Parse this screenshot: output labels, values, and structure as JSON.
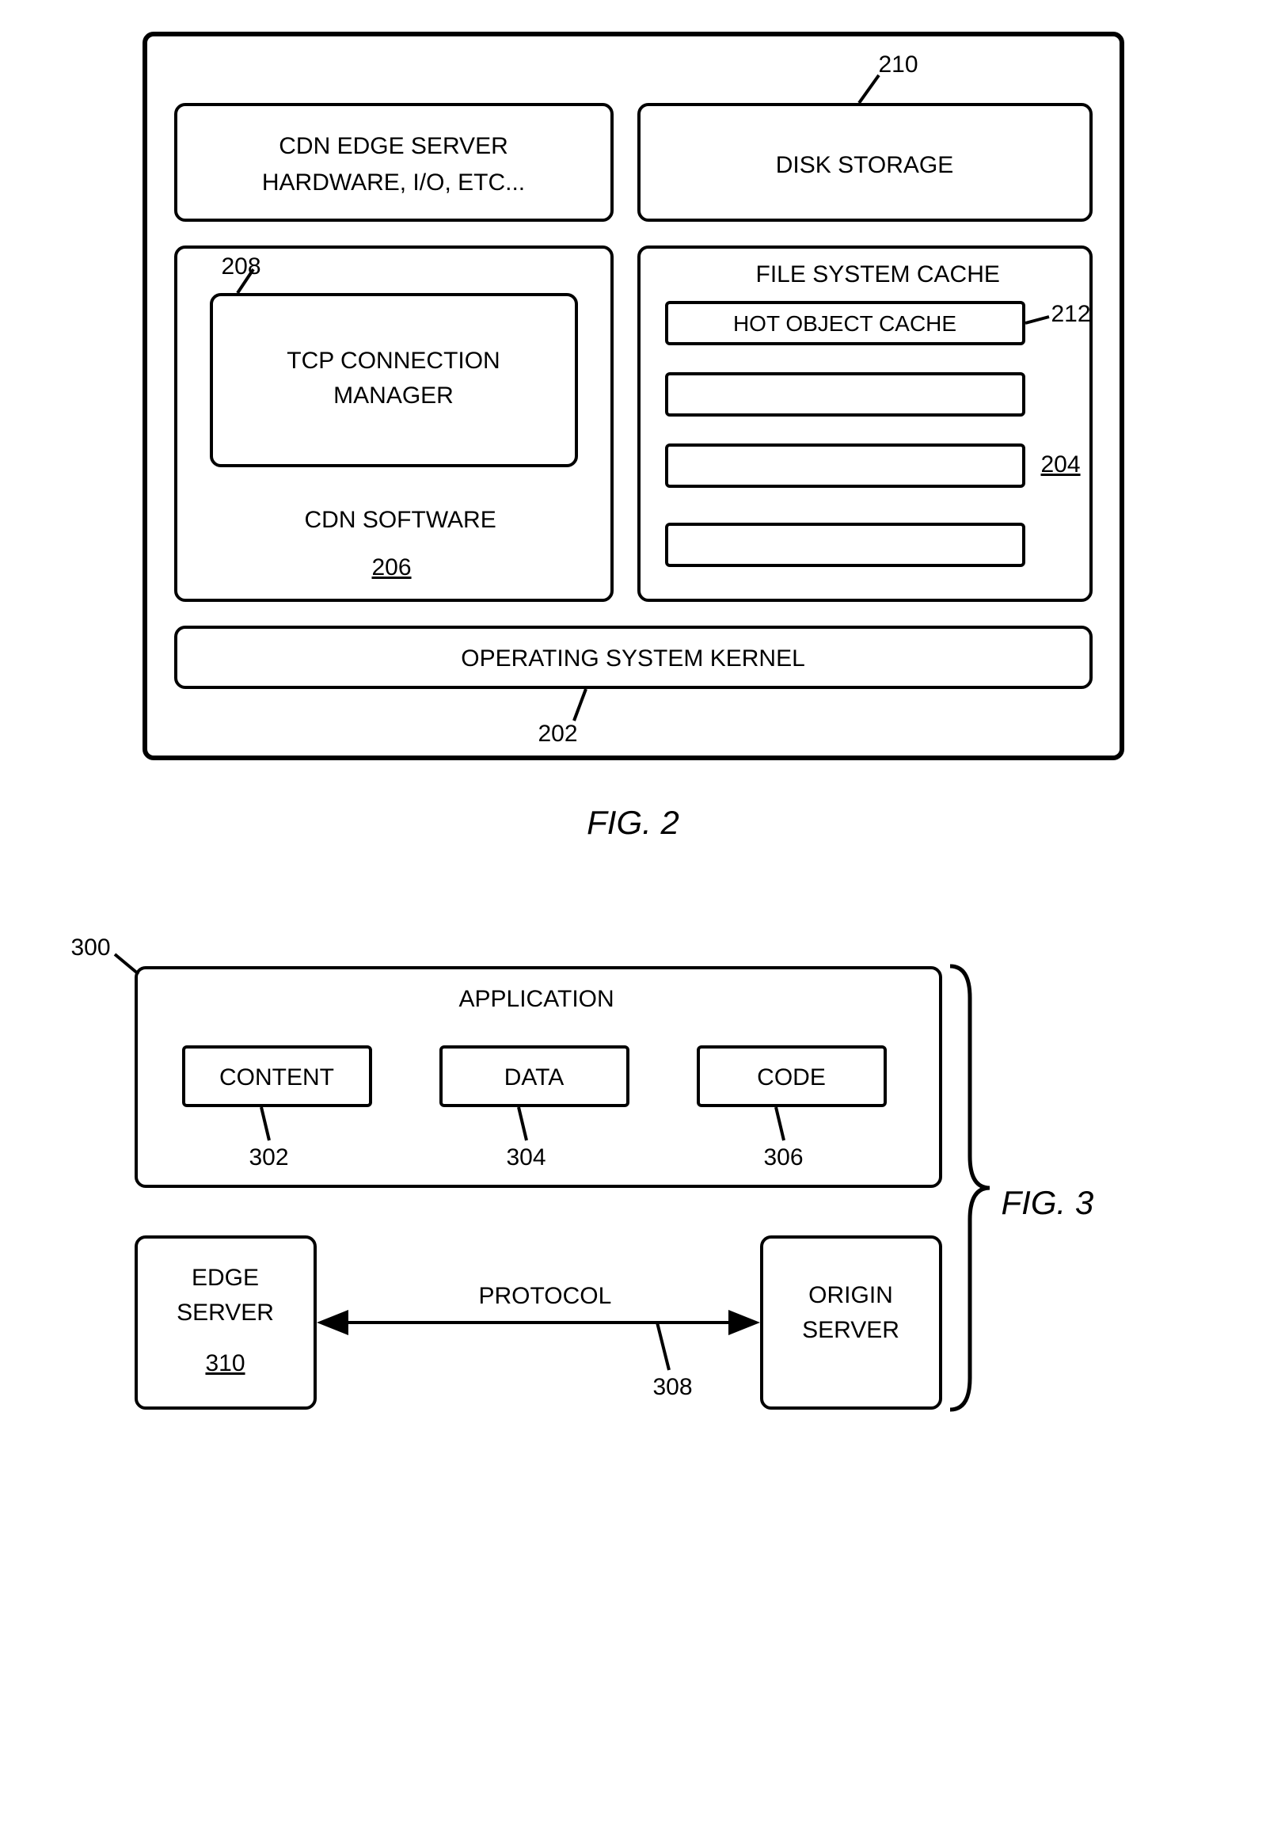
{
  "fig2": {
    "edge_server_hw_l1": "CDN EDGE SERVER",
    "edge_server_hw_l2": "HARDWARE, I/O, ETC...",
    "disk_storage": "DISK STORAGE",
    "tcp_conn_mgr_l1": "TCP CONNECTION",
    "tcp_conn_mgr_l2": "MANAGER",
    "cdn_software": "CDN SOFTWARE",
    "file_system_cache": "FILE SYSTEM CACHE",
    "hot_object_cache": "HOT OBJECT CACHE",
    "os_kernel": "OPERATING SYSTEM KERNEL",
    "ref_202": "202",
    "ref_204": "204",
    "ref_206": "206",
    "ref_208": "208",
    "ref_210": "210",
    "ref_212": "212",
    "caption": "FIG. 2"
  },
  "fig3": {
    "application": "APPLICATION",
    "content": "CONTENT",
    "data": "DATA",
    "code": "CODE",
    "edge_server_l1": "EDGE",
    "edge_server_l2": "SERVER",
    "origin_server_l1": "ORIGIN",
    "origin_server_l2": "SERVER",
    "protocol": "PROTOCOL",
    "ref_300": "300",
    "ref_302": "302",
    "ref_304": "304",
    "ref_306": "306",
    "ref_308": "308",
    "ref_310": "310",
    "caption": "FIG. 3"
  }
}
